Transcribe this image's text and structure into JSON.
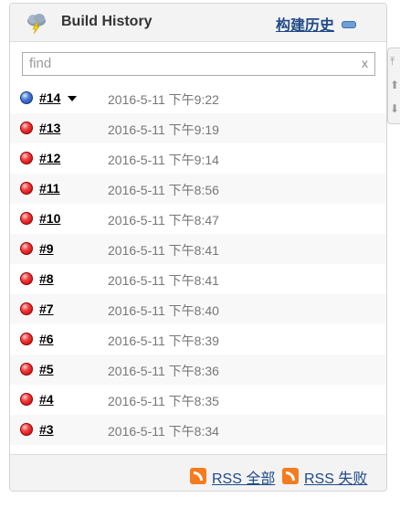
{
  "header": {
    "title": "Build History",
    "trend_link": "构建历史"
  },
  "search": {
    "placeholder": "find",
    "clear": "x"
  },
  "builds": [
    {
      "number": "#14",
      "date": "2016-5-11 下午9:22",
      "status": "blue",
      "has_dropdown": true
    },
    {
      "number": "#13",
      "date": "2016-5-11 下午9:19",
      "status": "red"
    },
    {
      "number": "#12",
      "date": "2016-5-11 下午9:14",
      "status": "red"
    },
    {
      "number": "#11",
      "date": "2016-5-11 下午8:56",
      "status": "red"
    },
    {
      "number": "#10",
      "date": "2016-5-11 下午8:47",
      "status": "red"
    },
    {
      "number": "#9",
      "date": "2016-5-11 下午8:41",
      "status": "red"
    },
    {
      "number": "#8",
      "date": "2016-5-11 下午8:41",
      "status": "red"
    },
    {
      "number": "#7",
      "date": "2016-5-11 下午8:40",
      "status": "red"
    },
    {
      "number": "#6",
      "date": "2016-5-11 下午8:39",
      "status": "red"
    },
    {
      "number": "#5",
      "date": "2016-5-11 下午8:36",
      "status": "red"
    },
    {
      "number": "#4",
      "date": "2016-5-11 下午8:35",
      "status": "red"
    },
    {
      "number": "#3",
      "date": "2016-5-11 下午8:34",
      "status": "red"
    }
  ],
  "footer": {
    "rss_all": "RSS 全部",
    "rss_failed": "RSS 失败"
  },
  "colors": {
    "link": "#204a87",
    "rss": "#f47c20",
    "failed": "#d40000",
    "success": "#3465a4"
  },
  "icons": {
    "weather": "cloud-lightning-icon",
    "collapse": "collapse-icon",
    "rss": "rss-icon",
    "side": [
      "page-top-icon",
      "page-up-icon",
      "page-down-icon"
    ]
  }
}
